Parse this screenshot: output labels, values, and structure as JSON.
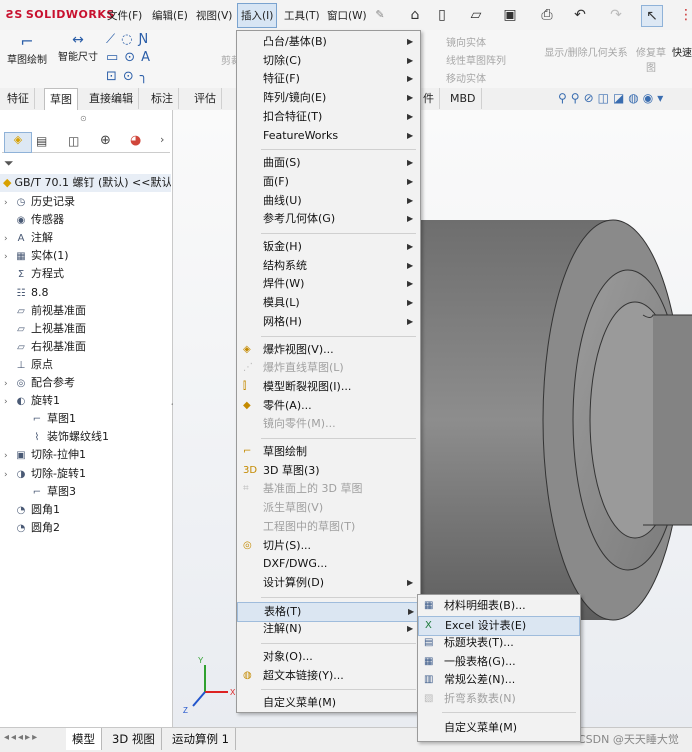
{
  "app": {
    "logo": "SOLIDWORKS",
    "logo_prefix": "ƧS"
  },
  "menubar": {
    "items": [
      "文件(F)",
      "编辑(E)",
      "视图(V)",
      "插入(I)",
      "工具(T)",
      "窗口(W)"
    ],
    "active": "插入(I)"
  },
  "toolbar": {
    "sketch": "草图绘制",
    "smart_dim": "智能尺寸",
    "mirror_entities": "镜向实体",
    "linear_pattern": "线性草图阵列",
    "move_entities": "移动实体",
    "show_relations": "显示/删除几何关系",
    "repair_sketch": "修复草图",
    "quick": "快速",
    "trim": "剪裁"
  },
  "tabs": [
    "特征",
    "草图",
    "直接编辑",
    "标注",
    "评估"
  ],
  "tabs_right": [
    "件",
    "MBD"
  ],
  "selected_tab": "草图",
  "tree": {
    "root": "GB/T 70.1 螺钉 (默认) <<默认",
    "items": [
      {
        "label": "历史记录",
        "indent": 0,
        "expand": true
      },
      {
        "label": "传感器",
        "indent": 0,
        "expand": false
      },
      {
        "label": "注解",
        "indent": 0,
        "expand": true
      },
      {
        "label": "实体(1)",
        "indent": 0,
        "expand": true
      },
      {
        "label": "方程式",
        "indent": 0,
        "expand": false
      },
      {
        "label": "8.8",
        "indent": 0,
        "expand": false
      },
      {
        "label": "前视基准面",
        "indent": 0,
        "expand": false
      },
      {
        "label": "上视基准面",
        "indent": 0,
        "expand": false
      },
      {
        "label": "右视基准面",
        "indent": 0,
        "expand": false
      },
      {
        "label": "原点",
        "indent": 0,
        "expand": false
      },
      {
        "label": "配合参考",
        "indent": 0,
        "expand": true
      },
      {
        "label": "旋转1",
        "indent": 0,
        "expand": true
      },
      {
        "label": "草图1",
        "indent": 1,
        "expand": false
      },
      {
        "label": "装饰螺纹线1",
        "indent": 1,
        "expand": false
      },
      {
        "label": "切除-拉伸1",
        "indent": 0,
        "expand": true
      },
      {
        "label": "切除-旋转1",
        "indent": 0,
        "expand": true
      },
      {
        "label": "草图3",
        "indent": 1,
        "expand": false
      },
      {
        "label": "圆角1",
        "indent": 0,
        "expand": false
      },
      {
        "label": "圆角2",
        "indent": 0,
        "expand": false
      }
    ]
  },
  "insert_menu": {
    "groups": [
      [
        {
          "label": "凸台/基体(B)",
          "submenu": true,
          "disabled": false
        },
        {
          "label": "切除(C)",
          "submenu": true,
          "disabled": false
        },
        {
          "label": "特征(F)",
          "submenu": true,
          "disabled": false
        },
        {
          "label": "阵列/镜向(E)",
          "submenu": true,
          "disabled": false
        },
        {
          "label": "扣合特征(T)",
          "submenu": true,
          "disabled": false
        },
        {
          "label": "FeatureWorks",
          "submenu": true,
          "disabled": false
        }
      ],
      [
        {
          "label": "曲面(S)",
          "submenu": true,
          "disabled": false
        },
        {
          "label": "面(F)",
          "submenu": true,
          "disabled": false
        },
        {
          "label": "曲线(U)",
          "submenu": true,
          "disabled": false
        },
        {
          "label": "参考几何体(G)",
          "submenu": true,
          "disabled": false
        }
      ],
      [
        {
          "label": "钣金(H)",
          "submenu": true,
          "disabled": false
        },
        {
          "label": "结构系统",
          "submenu": true,
          "disabled": false
        },
        {
          "label": "焊件(W)",
          "submenu": true,
          "disabled": false
        },
        {
          "label": "模具(L)",
          "submenu": true,
          "disabled": false
        },
        {
          "label": "网格(H)",
          "submenu": true,
          "disabled": false
        }
      ],
      [
        {
          "label": "爆炸视图(V)...",
          "submenu": false,
          "disabled": false
        },
        {
          "label": "爆炸直线草图(L)",
          "submenu": false,
          "disabled": true
        },
        {
          "label": "模型断裂视图(I)...",
          "submenu": false,
          "disabled": false
        },
        {
          "label": "零件(A)...",
          "submenu": false,
          "disabled": false
        },
        {
          "label": "镜向零件(M)...",
          "submenu": false,
          "disabled": true
        }
      ],
      [
        {
          "label": "草图绘制",
          "submenu": false,
          "disabled": false
        },
        {
          "label": "3D 草图(3)",
          "submenu": false,
          "disabled": false
        },
        {
          "label": "基准面上的 3D 草图",
          "submenu": false,
          "disabled": true
        },
        {
          "label": "派生草图(V)",
          "submenu": false,
          "disabled": true
        },
        {
          "label": "工程图中的草图(T)",
          "submenu": false,
          "disabled": true
        },
        {
          "label": "切片(S)...",
          "submenu": false,
          "disabled": false
        },
        {
          "label": "DXF/DWG...",
          "submenu": false,
          "disabled": false
        },
        {
          "label": "设计算例(D)",
          "submenu": true,
          "disabled": false
        }
      ],
      [
        {
          "label": "表格(T)",
          "submenu": true,
          "disabled": false,
          "highlight": true
        },
        {
          "label": "注解(N)",
          "submenu": true,
          "disabled": false
        }
      ],
      [
        {
          "label": "对象(O)...",
          "submenu": false,
          "disabled": false
        },
        {
          "label": "超文本链接(Y)...",
          "submenu": false,
          "disabled": false
        }
      ],
      [
        {
          "label": "自定义菜单(M)",
          "submenu": false,
          "disabled": false
        }
      ]
    ]
  },
  "table_submenu": {
    "items": [
      {
        "label": "材料明细表(B)...",
        "disabled": false
      },
      {
        "label": "Excel 设计表(E)",
        "disabled": false,
        "highlight": true
      },
      {
        "label": "标题块表(T)...",
        "disabled": false
      },
      {
        "label": "一般表格(G)...",
        "disabled": false
      },
      {
        "label": "常规公差(N)...",
        "disabled": false
      },
      {
        "label": "折弯系数表(N)",
        "disabled": true
      }
    ],
    "footer": "自定义菜单(M)"
  },
  "bottom_tabs": [
    "模型",
    "3D 视图",
    "运动算例 1"
  ],
  "watermark": "CSDN @天天睡大觉",
  "colors": {
    "accent": "#c8102e",
    "highlight": "#dbe6f2",
    "menu_bg": "#f2f2f2"
  }
}
